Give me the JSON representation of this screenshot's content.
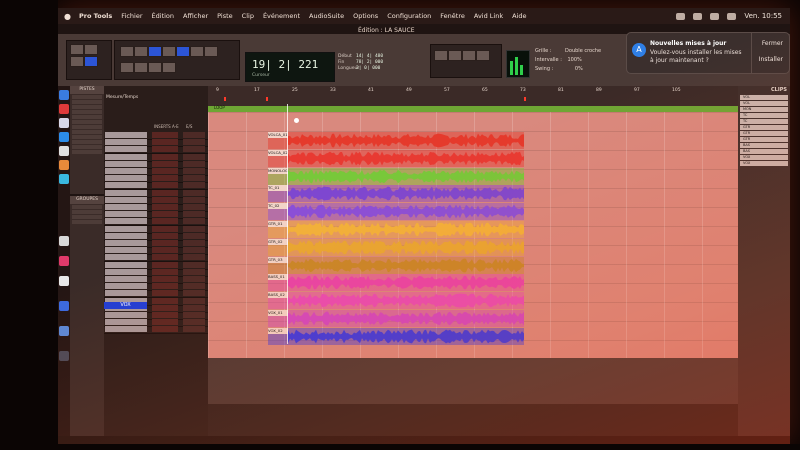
{
  "menubar": {
    "apple": "",
    "items": [
      "Pro Tools",
      "Fichier",
      "Édition",
      "Afficher",
      "Piste",
      "Clip",
      "Événement",
      "AudioSuite",
      "Options",
      "Configuration",
      "Fenêtre",
      "Avid Link",
      "Aide"
    ],
    "clock": "Ven. 10:55"
  },
  "window": {
    "title": "Édition : LA SAUCE"
  },
  "counter": {
    "main": "19| 2| 221",
    "mode": "Curseur",
    "labels": [
      "Début",
      "Fin",
      "Longueur"
    ],
    "values": [
      "14| 4| 480",
      "78| 2| 000",
      "3| 0| 000"
    ]
  },
  "grid": {
    "grid_label": "Grille :",
    "grid_value": "Double croche",
    "nudge_label": "Intervalle :",
    "nudge_value": "100%",
    "swing_label": "Swing :",
    "swing_value": "0%"
  },
  "notification": {
    "title": "Nouvelles mises à jour",
    "body": "Voulez-vous installer les mises à jour maintenant ?",
    "close_label": "Fermer",
    "install_label": "Installer"
  },
  "panes": {
    "tracks": "PISTES",
    "groups": "GROUPES",
    "clips": "CLIPS",
    "memory": "Mesure/Temps",
    "inserts": "INSERTS A-E",
    "io": "E/S"
  },
  "ruler": {
    "bars": [
      "9",
      "17",
      "25",
      "33",
      "41",
      "49",
      "57",
      "65",
      "73",
      "81",
      "89",
      "97",
      "105"
    ],
    "marker_lane": "LOOP"
  },
  "vox_label": "VOX",
  "tracks": [
    {
      "name": "VOLCA_01",
      "color": "#e53a2c"
    },
    {
      "name": "VOLCA_02",
      "color": "#e83a32"
    },
    {
      "name": "MONOLOG",
      "color": "#78c83a"
    },
    {
      "name": "TC_01",
      "color": "#7e47d0"
    },
    {
      "name": "TC_02",
      "color": "#8a4fd8"
    },
    {
      "name": "GTR_01",
      "color": "#f2b23a"
    },
    {
      "name": "GTR_02",
      "color": "#e8a832"
    },
    {
      "name": "GTR_03",
      "color": "#c88828"
    },
    {
      "name": "BASS_01",
      "color": "#e844a8"
    },
    {
      "name": "BASS_02",
      "color": "#e84cb4"
    },
    {
      "name": "VOX_01",
      "color": "#d248c0"
    },
    {
      "name": "VOX_02",
      "color": "#3a3ae0"
    }
  ],
  "clips_list": [
    "VOL",
    "VOL",
    "MON",
    "TC",
    "TC",
    "GTR",
    "GTR",
    "GTR",
    "BAS",
    "BAS",
    "VOX",
    "VOX"
  ],
  "colors": {
    "timeline_bg": "#d9897e",
    "accent": "#2c55d6"
  }
}
